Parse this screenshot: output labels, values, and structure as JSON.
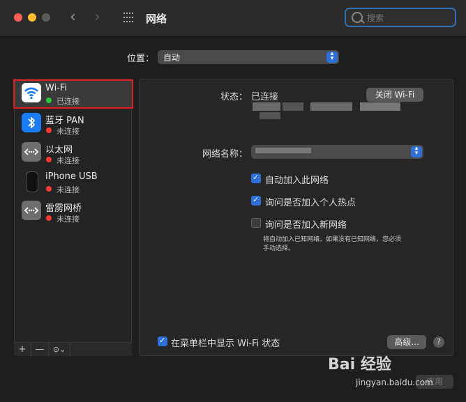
{
  "window": {
    "title": "网络"
  },
  "search": {
    "placeholder": "搜索"
  },
  "location": {
    "label": "位置：",
    "value": "自动"
  },
  "sidebar": {
    "items": [
      {
        "name": "Wi-Fi",
        "status": "已连接",
        "status_color": "#28c840",
        "icon": "wifi-icon"
      },
      {
        "name": "蓝牙 PAN",
        "status": "未连接",
        "status_color": "#ff3b30",
        "icon": "bluetooth-icon"
      },
      {
        "name": "以太网",
        "status": "未连接",
        "status_color": "#ff3b30",
        "icon": "ethernet-icon"
      },
      {
        "name": "iPhone USB",
        "status": "未连接",
        "status_color": "#ff3b30",
        "icon": "iphone-icon"
      },
      {
        "name": "雷雳网桥",
        "status": "未连接",
        "status_color": "#ff3b30",
        "icon": "thunderbolt-bridge-icon"
      }
    ],
    "toolbar": {
      "add": "+",
      "remove": "—",
      "more": "⊙⌄"
    }
  },
  "detail": {
    "status_label": "状态：",
    "status_value": "已连接",
    "turn_off_button": "关闭 Wi-Fi",
    "network_name_label": "网络名称：",
    "checkbox_auto_join": "自动加入此网络",
    "checkbox_ask_hotspot": "询问是否加入个人热点",
    "checkbox_ask_new": "询问是否加入新网络",
    "hint_line1": "将自动加入已知网络。如果没有已知网络，您必须",
    "hint_line2": "手动选择。",
    "show_in_menubar": "在菜单栏中显示 Wi-Fi 状态",
    "advanced_button": "高级...",
    "help": "?",
    "apply_button": "应用"
  },
  "watermark": {
    "main": "Bai 经验",
    "sub": "jingyan.baidu.com"
  },
  "colors": {
    "accent": "#2f6fd8",
    "highlight_border": "#e02020"
  }
}
